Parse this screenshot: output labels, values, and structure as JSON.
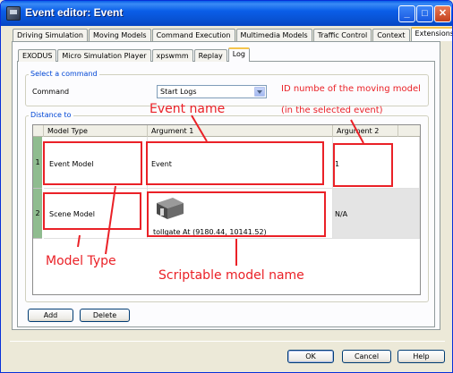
{
  "window": {
    "title": "Event editor: Event",
    "controls": {
      "minimize": "_",
      "maximize": "□",
      "close": "✕"
    }
  },
  "tabs_top": [
    {
      "label": "Driving Simulation",
      "active": false
    },
    {
      "label": "Moving Models",
      "active": false
    },
    {
      "label": "Command Execution",
      "active": false
    },
    {
      "label": "Multimedia Models",
      "active": false
    },
    {
      "label": "Traffic Control",
      "active": false
    },
    {
      "label": "Context",
      "active": false
    },
    {
      "label": "Extensions",
      "active": true
    }
  ],
  "tabs_inner": [
    {
      "label": "EXODUS",
      "active": false
    },
    {
      "label": "Micro Simulation Player",
      "active": false
    },
    {
      "label": "xpswmm",
      "active": false
    },
    {
      "label": "Replay",
      "active": false
    },
    {
      "label": "Log",
      "active": true
    }
  ],
  "select_command": {
    "legend": "Select a command",
    "label": "Command",
    "value": "Start Logs"
  },
  "distance": {
    "legend": "Distance to",
    "columns": [
      "Model Type",
      "Argument 1",
      "Argument 2"
    ],
    "rows": [
      {
        "index": "1",
        "model_type": "Event Model",
        "argument1": "Event",
        "argument2": "1"
      },
      {
        "index": "2",
        "model_type": "Scene Model",
        "argument1": "tollgate At (9180.44, 10141.52)",
        "argument2": "N/A"
      }
    ]
  },
  "buttons": {
    "add": "Add",
    "delete": "Delete",
    "ok": "OK",
    "cancel": "Cancel",
    "help": "Help"
  },
  "annotations": {
    "event_name": "Event name",
    "id_line1": "ID numbe of the moving model",
    "id_line2": "(in the selected event)",
    "model_type": "Model Type",
    "scriptable": "Scriptable model name"
  },
  "colors": {
    "annotation": "#ea2127",
    "titlebar": "#0a5ee8",
    "row_header": "#8fbc8f"
  }
}
